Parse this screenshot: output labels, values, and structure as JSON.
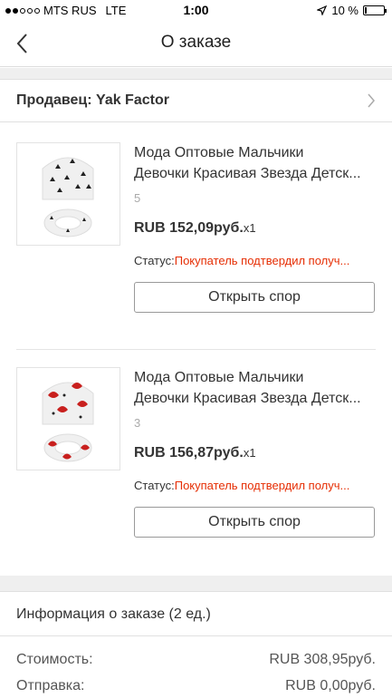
{
  "status_bar": {
    "carrier": "MTS RUS",
    "network": "LTE",
    "time": "1:00",
    "battery": "10 %",
    "battery_level": 0.1
  },
  "nav": {
    "title": "О заказе"
  },
  "seller": {
    "label": "Продавец: Yak Factor"
  },
  "items": [
    {
      "title_line1": "Мода Оптовые Мальчики",
      "title_line2": "Девочки Красивая Звезда Детск...",
      "qty": "5",
      "price": "RUB 152,09руб.",
      "mult": "x1",
      "status_label": "Статус:",
      "status_value": "Покупатель подтвердил получ...",
      "button": "Открыть спор",
      "image_icon": "black-star-hat-scarf",
      "accent": "#222222"
    },
    {
      "title_line1": "Мода Оптовые Мальчики",
      "title_line2": "Девочки Красивая Звезда Детск...",
      "qty": "3",
      "price": "RUB 156,87руб.",
      "mult": "x1",
      "status_label": "Статус:",
      "status_value": "Покупатель подтвердил получ...",
      "button": "Открыть спор",
      "image_icon": "red-fox-hat-scarf",
      "accent": "#c8201e"
    }
  ],
  "order_info": {
    "title": "Информация о заказе (2 ед.)",
    "cost_label": "Стоимость:",
    "cost_value": "RUB 308,95руб.",
    "shipping_label": "Отправка:",
    "shipping_value": "RUB 0,00руб."
  },
  "colors": {
    "status_red": "#e62e04",
    "separator": "#efefef"
  }
}
